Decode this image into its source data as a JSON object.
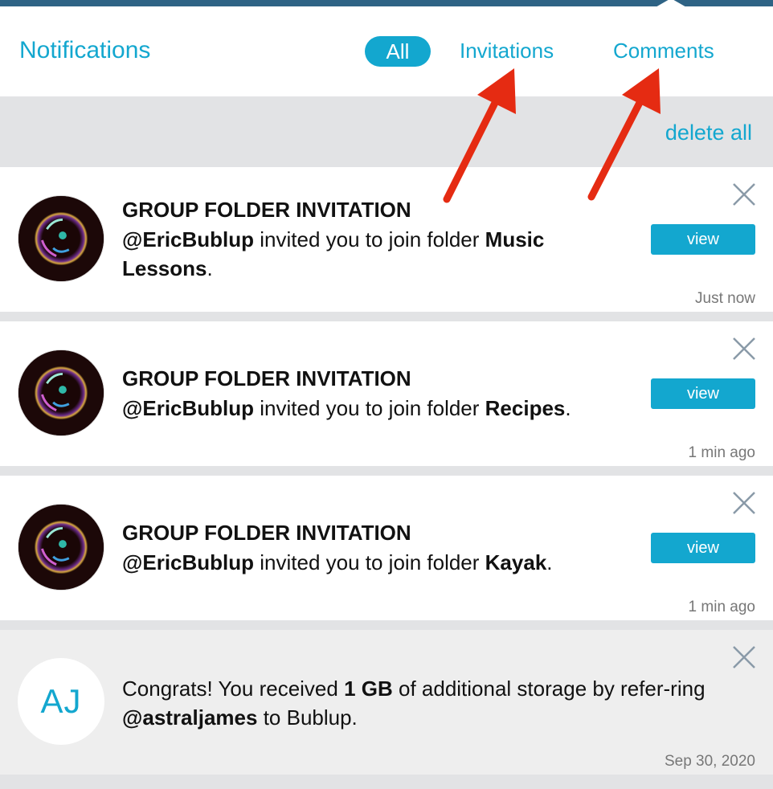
{
  "header": {
    "title": "Notifications",
    "tabs": [
      {
        "label": "All",
        "active": true
      },
      {
        "label": "Invitations",
        "active": false
      },
      {
        "label": "Comments",
        "active": false
      }
    ]
  },
  "toolbar": {
    "delete_all_label": "delete all"
  },
  "notifications": [
    {
      "type": "invitation",
      "title": "GROUP FOLDER INVITATION",
      "user": "@EricBublup",
      "text": " invited you to join folder ",
      "folder": "Music Lessons",
      "end": ".",
      "button": "view",
      "time": "Just now"
    },
    {
      "type": "invitation",
      "title": "GROUP FOLDER INVITATION",
      "user": "@EricBublup",
      "text": " invited you to join folder ",
      "folder": "Recipes",
      "end": ".",
      "button": "view",
      "time": "1 min ago"
    },
    {
      "type": "invitation",
      "title": "GROUP FOLDER INVITATION",
      "user": "@EricBublup",
      "text": " invited you to join folder ",
      "folder": "Kayak",
      "end": ".",
      "button": "view",
      "time": "1 min ago"
    },
    {
      "type": "storage",
      "initials": "AJ",
      "pre": "Congrats! You received ",
      "amount": "1 GB",
      "mid": " of additional storage by refer-ring ",
      "user": "@astraljames",
      "post": " to Bublup.",
      "time": "Sep 30, 2020"
    }
  ],
  "colors": {
    "accent": "#13a7cf",
    "annotation_arrow": "#e52b12",
    "top_bar": "#2e6385"
  },
  "icons": {
    "close": "close-icon",
    "bubble_avatar": "bubble-avatar-icon"
  }
}
